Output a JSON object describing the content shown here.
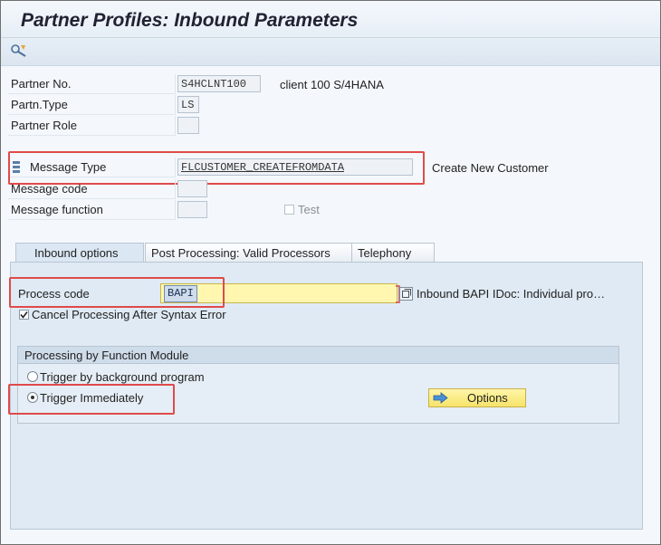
{
  "window": {
    "title": "Partner Profiles: Inbound Parameters"
  },
  "toolbar": {
    "display_change_icon": "display-change-icon"
  },
  "header": {
    "partner_no_label": "Partner No.",
    "partner_no_value": "S4HCLNT100",
    "partner_no_desc": "client 100 S/4HANA",
    "partn_type_label": "Partn.Type",
    "partn_type_value": "LS",
    "partner_role_label": "Partner Role",
    "partner_role_value": "",
    "message_type_label": "Message Type",
    "message_type_value": "FLCUSTOMER_CREATEFROMDATA",
    "message_type_desc": "Create New Customer",
    "message_code_label": "Message code",
    "message_function_label": "Message function",
    "test_label": "Test"
  },
  "tabs": [
    {
      "label": "Inbound options"
    },
    {
      "label": "Post Processing: Valid Processors"
    },
    {
      "label": "Telephony"
    }
  ],
  "inbound": {
    "process_code_label": "Process code",
    "process_code_value": "BAPI",
    "process_code_desc": "Inbound BAPI IDoc: Individual pro…",
    "cancel_label": "Cancel Processing After Syntax Error",
    "cancel_checked": true,
    "group_title": "Processing by Function Module",
    "radio_background": "Trigger by background program",
    "radio_immediately": "Trigger Immediately",
    "selected": "immediately",
    "options_button": "Options"
  },
  "colors": {
    "highlight_box": "#e04a4a",
    "required_field": "#fff7b0",
    "button": "#f7e26a"
  }
}
